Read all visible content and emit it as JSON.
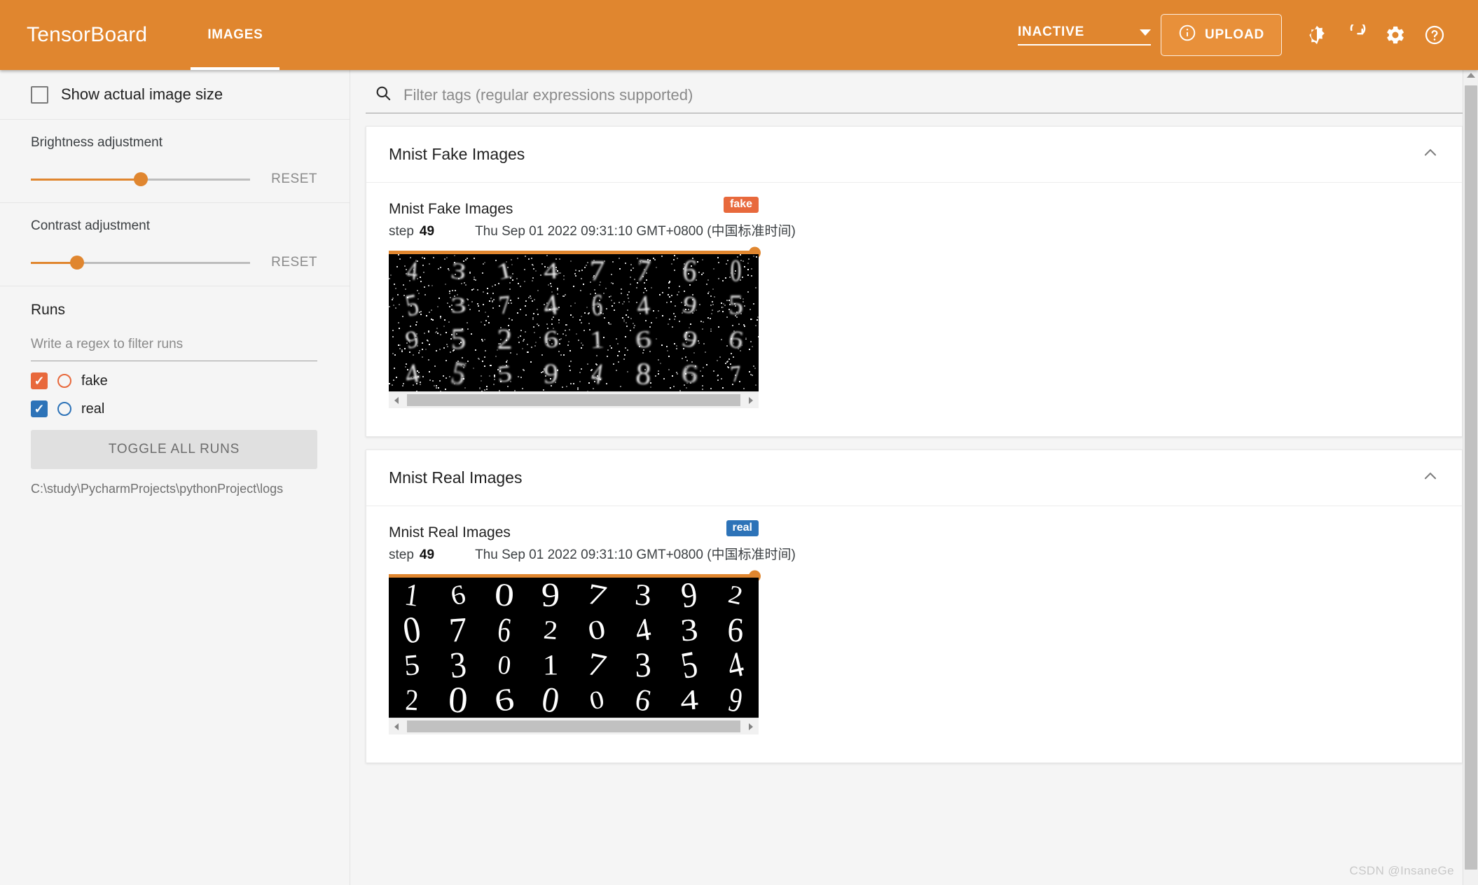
{
  "app": {
    "brand": "TensorBoard",
    "accent_color": "#e0862f",
    "tabs": [
      {
        "label": "IMAGES",
        "active": true
      }
    ],
    "status_select": {
      "value": "INACTIVE"
    },
    "upload_button": {
      "label": "UPLOAD"
    },
    "icons": [
      {
        "name": "brightness-icon"
      },
      {
        "name": "refresh-icon"
      },
      {
        "name": "settings-gear-icon"
      },
      {
        "name": "help-question-icon"
      }
    ]
  },
  "sidebar": {
    "show_actual_image_size": {
      "label": "Show actual image size",
      "checked": false
    },
    "brightness": {
      "label": "Brightness adjustment",
      "reset_label": "RESET",
      "percent": 50
    },
    "contrast": {
      "label": "Contrast adjustment",
      "reset_label": "RESET",
      "percent": 21
    },
    "runs": {
      "title": "Runs",
      "filter_placeholder": "Write a regex to filter runs",
      "filter_value": "",
      "items": [
        {
          "label": "fake",
          "checked": true,
          "color": "#e8693c"
        },
        {
          "label": "real",
          "checked": true,
          "color": "#2d73b8"
        }
      ],
      "toggle_all_label": "TOGGLE ALL RUNS",
      "logdir": "C:\\study\\PycharmProjects\\pythonProject\\logs"
    }
  },
  "main": {
    "filter": {
      "placeholder": "Filter tags (regular expressions supported)",
      "value": "",
      "icon": "search-icon"
    },
    "cards": [
      {
        "header": "Mnist Fake Images",
        "collapse_icon": "chevron-up-icon",
        "image": {
          "title": "Mnist Fake Images",
          "badge": "fake",
          "badge_color": "#e8693c",
          "step_word": "step",
          "step_value": "49",
          "timestamp": "Thu Sep 01 2022 09:31:10 GMT+0800 (中国标准时间)",
          "slider_percent": 100,
          "kind": "fake",
          "grid_rows": [
            [
              "4",
              "3",
              "1",
              "4",
              "7",
              "7",
              "6",
              "0"
            ],
            [
              "5",
              "3",
              "7",
              "4",
              "6",
              "4",
              "9",
              "5"
            ],
            [
              "9",
              "5",
              "2",
              "6",
              "1",
              "6",
              "9",
              "6"
            ],
            [
              "4",
              "5",
              "5",
              "9",
              "4",
              "8",
              "6",
              "7"
            ]
          ]
        }
      },
      {
        "header": "Mnist Real Images",
        "collapse_icon": "chevron-up-icon",
        "image": {
          "title": "Mnist Real Images",
          "badge": "real",
          "badge_color": "#2d73b8",
          "step_word": "step",
          "step_value": "49",
          "timestamp": "Thu Sep 01 2022 09:31:10 GMT+0800 (中国标准时间)",
          "slider_percent": 100,
          "kind": "real",
          "grid_rows": [
            [
              "1",
              "6",
              "0",
              "9",
              "7",
              "3",
              "9",
              "2"
            ],
            [
              "0",
              "7",
              "6",
              "2",
              "0",
              "4",
              "3",
              "6"
            ],
            [
              "5",
              "3",
              "0",
              "1",
              "7",
              "3",
              "5",
              "4"
            ],
            [
              "2",
              "0",
              "6",
              "0",
              "0",
              "6",
              "4",
              "9"
            ]
          ]
        }
      }
    ]
  },
  "watermark": "CSDN @InsaneGe"
}
